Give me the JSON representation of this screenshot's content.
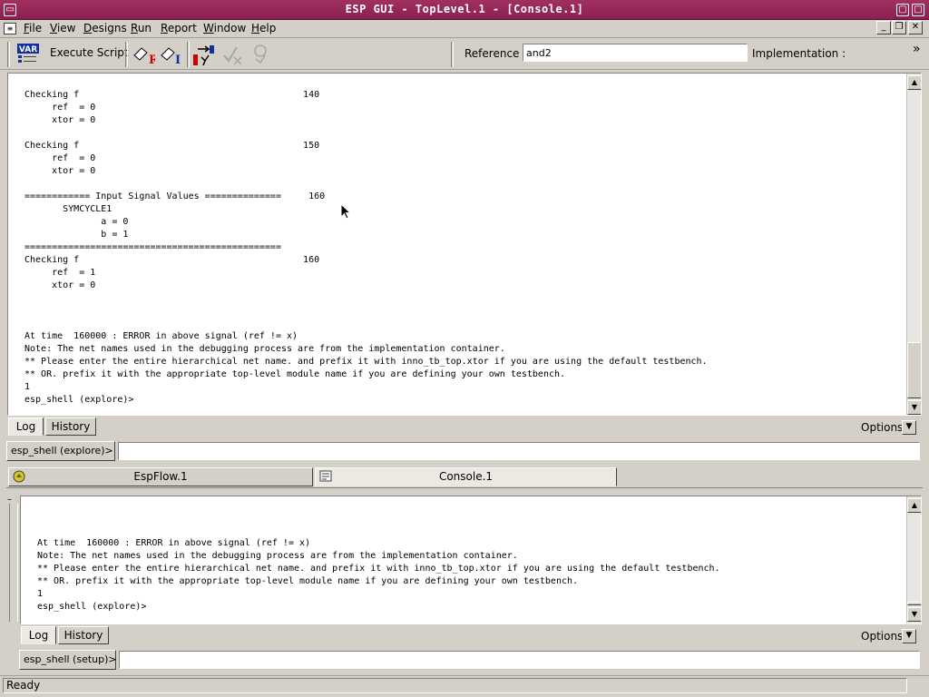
{
  "window": {
    "title": "ESP GUI - TopLevel.1 - [Console.1]"
  },
  "menu": [
    "File",
    "View",
    "Designs",
    "Run",
    "Report",
    "Window",
    "Help"
  ],
  "menu_underline": [
    "F",
    "V",
    "D",
    "R",
    "R",
    "W",
    "H"
  ],
  "toolbar": {
    "execute_label": "Execute Script",
    "var_icon_text": "VAR",
    "reference_label": "Reference :",
    "reference_value": "and2",
    "implementation_label": "Implementation :",
    "more": "»"
  },
  "upper_console": {
    "text": "Checking f                                         140\n     ref  = 0\n     xtor = 0\n\nChecking f                                         150\n     ref  = 0\n     xtor = 0\n\n============ Input Signal Values ==============     160\n       SYMCYCLE1\n              a = 0\n              b = 1\n===============================================\nChecking f                                         160\n     ref  = 1\n     xtor = 0\n\n\n\nAt time  160000 : ERROR in above signal (ref != x)\nNote: The net names used in the debugging process are from the implementation container.\n** Please enter the entire hierarchical net name. and prefix it with inno_tb_top.xtor if you are using the default testbench.\n** OR. prefix it with the appropriate top-level module name if you are defining your own testbench.\n1\nesp_shell (explore)>",
    "tabs": [
      "Log",
      "History"
    ],
    "options_label": "Options:",
    "shell_prompt": "esp_shell (explore)>",
    "shell_input": ""
  },
  "doc_tabs": [
    {
      "label": "EspFlow.1",
      "icon": "flow-icon"
    },
    {
      "label": "Console.1",
      "icon": "console-icon"
    }
  ],
  "lower_console": {
    "text": "\n\n\nAt time  160000 : ERROR in above signal (ref != x)\nNote: The net names used in the debugging process are from the implementation container.\n** Please enter the entire hierarchical net name. and prefix it with inno_tb_top.xtor if you are using the default testbench.\n** OR. prefix it with the appropriate top-level module name if you are defining your own testbench.\n1\nesp_shell (explore)>",
    "tabs": [
      "Log",
      "History"
    ],
    "options_label": "Options:",
    "shell_prompt": "esp_shell (setup)>",
    "shell_input": ""
  },
  "status": {
    "text": "Ready"
  },
  "colors": {
    "titlebar": "#8a2050",
    "window_bg": "#d4d0c8",
    "error_icon_red": "#cc0000",
    "icon_blue": "#1030a0"
  }
}
